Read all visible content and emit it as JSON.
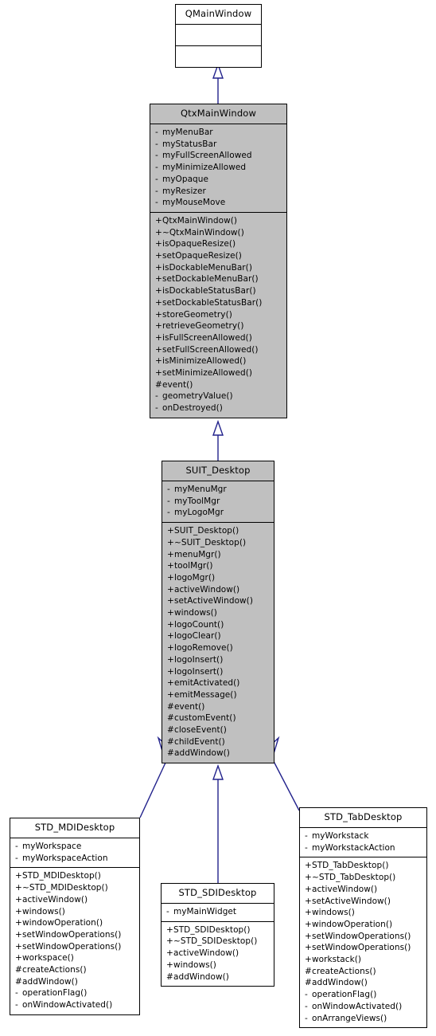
{
  "diagram": {
    "type": "uml-class-inheritance",
    "title": "SUIT_Desktop class inheritance diagram",
    "fill_color_base": "#c0c0c0",
    "fill_color_derived": "#ffffff",
    "border_color": "#000000",
    "connector_color": "#22228c",
    "relationship": "generalization"
  },
  "classes": {
    "qmainwindow": {
      "name": "QMainWindow",
      "attributes": [],
      "operations": [],
      "empty_compartments": 2
    },
    "qtxmainwindow": {
      "name": "QtxMainWindow",
      "attributes": [
        {
          "vis": "-",
          "label": "myMenuBar"
        },
        {
          "vis": "-",
          "label": "myStatusBar"
        },
        {
          "vis": "-",
          "label": "myFullScreenAllowed"
        },
        {
          "vis": "-",
          "label": "myMinimizeAllowed"
        },
        {
          "vis": "-",
          "label": "myOpaque"
        },
        {
          "vis": "-",
          "label": "myResizer"
        },
        {
          "vis": "-",
          "label": "myMouseMove"
        }
      ],
      "operations": [
        {
          "vis": "+",
          "label": "QtxMainWindow()"
        },
        {
          "vis": "+",
          "label": "~QtxMainWindow()"
        },
        {
          "vis": "+",
          "label": "isOpaqueResize()"
        },
        {
          "vis": "+",
          "label": "setOpaqueResize()"
        },
        {
          "vis": "+",
          "label": "isDockableMenuBar()"
        },
        {
          "vis": "+",
          "label": "setDockableMenuBar()"
        },
        {
          "vis": "+",
          "label": "isDockableStatusBar()"
        },
        {
          "vis": "+",
          "label": "setDockableStatusBar()"
        },
        {
          "vis": "+",
          "label": "storeGeometry()"
        },
        {
          "vis": "+",
          "label": "retrieveGeometry()"
        },
        {
          "vis": "+",
          "label": "isFullScreenAllowed()"
        },
        {
          "vis": "+",
          "label": "setFullScreenAllowed()"
        },
        {
          "vis": "+",
          "label": "isMinimizeAllowed()"
        },
        {
          "vis": "+",
          "label": "setMinimizeAllowed()"
        },
        {
          "vis": "#",
          "label": "event()"
        },
        {
          "vis": "-",
          "label": "geometryValue()"
        },
        {
          "vis": "-",
          "label": "onDestroyed()"
        }
      ]
    },
    "suit_desktop": {
      "name": "SUIT_Desktop",
      "attributes": [
        {
          "vis": "-",
          "label": "myMenuMgr"
        },
        {
          "vis": "-",
          "label": "myToolMgr"
        },
        {
          "vis": "-",
          "label": "myLogoMgr"
        }
      ],
      "operations": [
        {
          "vis": "+",
          "label": "SUIT_Desktop()"
        },
        {
          "vis": "+",
          "label": "~SUIT_Desktop()"
        },
        {
          "vis": "+",
          "label": "menuMgr()"
        },
        {
          "vis": "+",
          "label": "toolMgr()"
        },
        {
          "vis": "+",
          "label": "logoMgr()"
        },
        {
          "vis": "+",
          "label": "activeWindow()"
        },
        {
          "vis": "+",
          "label": "setActiveWindow()"
        },
        {
          "vis": "+",
          "label": "windows()"
        },
        {
          "vis": "+",
          "label": "logoCount()"
        },
        {
          "vis": "+",
          "label": "logoClear()"
        },
        {
          "vis": "+",
          "label": "logoRemove()"
        },
        {
          "vis": "+",
          "label": "logoInsert()"
        },
        {
          "vis": "+",
          "label": "logoInsert()"
        },
        {
          "vis": "+",
          "label": "emitActivated()"
        },
        {
          "vis": "+",
          "label": "emitMessage()"
        },
        {
          "vis": "#",
          "label": "event()"
        },
        {
          "vis": "#",
          "label": "customEvent()"
        },
        {
          "vis": "#",
          "label": "closeEvent()"
        },
        {
          "vis": "#",
          "label": "childEvent()"
        },
        {
          "vis": "#",
          "label": "addWindow()"
        }
      ]
    },
    "std_mdidesktop": {
      "name": "STD_MDIDesktop",
      "attributes": [
        {
          "vis": "-",
          "label": "myWorkspace"
        },
        {
          "vis": "-",
          "label": "myWorkspaceAction"
        }
      ],
      "operations": [
        {
          "vis": "+",
          "label": "STD_MDIDesktop()"
        },
        {
          "vis": "+",
          "label": "~STD_MDIDesktop()"
        },
        {
          "vis": "+",
          "label": "activeWindow()"
        },
        {
          "vis": "+",
          "label": "windows()"
        },
        {
          "vis": "+",
          "label": "windowOperation()"
        },
        {
          "vis": "+",
          "label": "setWindowOperations()"
        },
        {
          "vis": "+",
          "label": "setWindowOperations()"
        },
        {
          "vis": "+",
          "label": "workspace()"
        },
        {
          "vis": "#",
          "label": "createActions()"
        },
        {
          "vis": "#",
          "label": "addWindow()"
        },
        {
          "vis": "-",
          "label": "operationFlag()"
        },
        {
          "vis": "-",
          "label": "onWindowActivated()"
        }
      ]
    },
    "std_sdidesktop": {
      "name": "STD_SDIDesktop",
      "attributes": [
        {
          "vis": "-",
          "label": "myMainWidget"
        }
      ],
      "operations": [
        {
          "vis": "+",
          "label": "STD_SDIDesktop()"
        },
        {
          "vis": "+",
          "label": "~STD_SDIDesktop()"
        },
        {
          "vis": "+",
          "label": "activeWindow()"
        },
        {
          "vis": "+",
          "label": "windows()"
        },
        {
          "vis": "#",
          "label": "addWindow()"
        }
      ]
    },
    "std_tabdesktop": {
      "name": "STD_TabDesktop",
      "attributes": [
        {
          "vis": "-",
          "label": "myWorkstack"
        },
        {
          "vis": "-",
          "label": "myWorkstackAction"
        }
      ],
      "operations": [
        {
          "vis": "+",
          "label": "STD_TabDesktop()"
        },
        {
          "vis": "+",
          "label": "~STD_TabDesktop()"
        },
        {
          "vis": "+",
          "label": "activeWindow()"
        },
        {
          "vis": "+",
          "label": "setActiveWindow()"
        },
        {
          "vis": "+",
          "label": "windows()"
        },
        {
          "vis": "+",
          "label": "windowOperation()"
        },
        {
          "vis": "+",
          "label": "setWindowOperations()"
        },
        {
          "vis": "+",
          "label": "setWindowOperations()"
        },
        {
          "vis": "+",
          "label": "workstack()"
        },
        {
          "vis": "#",
          "label": "createActions()"
        },
        {
          "vis": "#",
          "label": "addWindow()"
        },
        {
          "vis": "-",
          "label": "operationFlag()"
        },
        {
          "vis": "-",
          "label": "onWindowActivated()"
        },
        {
          "vis": "-",
          "label": "onArrangeViews()"
        }
      ]
    }
  }
}
